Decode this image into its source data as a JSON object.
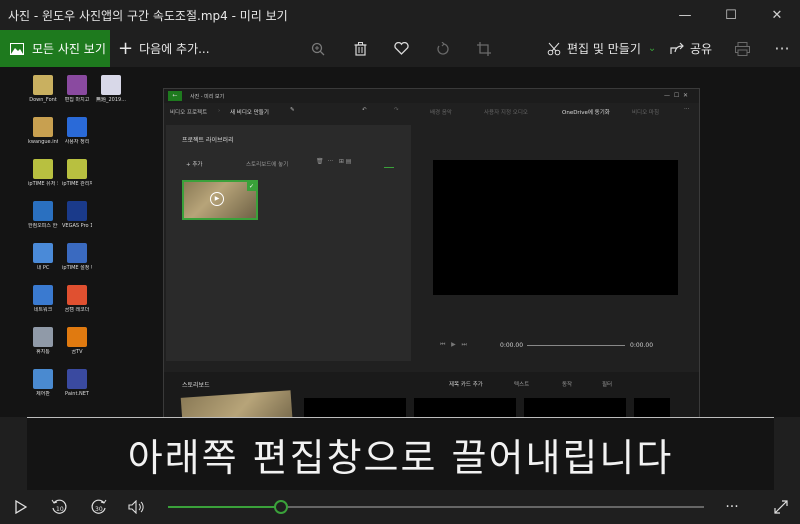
{
  "window": {
    "title": "사진 - 윈도우 사진앱의 구간 속도조절.mp4 - 미리 보기",
    "minimize": "—",
    "maximize": "☐",
    "close": "✕"
  },
  "toolbar": {
    "all_photos": "모든 사진 보기",
    "add_to": "다음에 추가...",
    "edit_create": "편집 및 만들기",
    "share": "공유",
    "more": "···"
  },
  "desktop_icons": [
    {
      "label": "Down_Font",
      "color": "#c9b060"
    },
    {
      "label": "편집 마치고",
      "color": "#8a4aa0"
    },
    {
      "label": "無題_2019...",
      "color": "#d8d8e8"
    },
    {
      "label": "kwangue.int",
      "color": "#c8a050"
    },
    {
      "label": "사용자 정리",
      "color": "#2a6ad8"
    },
    {
      "label": "ipTIME 유저 도우미",
      "color": "#b8c040"
    },
    {
      "label": "ipTIME 관리자",
      "color": "#b8c040"
    },
    {
      "label": "한컴오피스 한글 2014",
      "color": "#2a70c0"
    },
    {
      "label": "VEGAS Pro 15.0",
      "color": "#1a3a8a"
    },
    {
      "label": "내 PC",
      "color": "#4a8ad8"
    },
    {
      "label": "ipTIME 설정 마법사",
      "color": "#3a6ac0"
    },
    {
      "label": "네트워크",
      "color": "#3a7ad0"
    },
    {
      "label": "곰캠 레코더",
      "color": "#e05030"
    },
    {
      "label": "휴지통",
      "color": "#909aa8"
    },
    {
      "label": "곰TV",
      "color": "#e07a10"
    },
    {
      "label": "제어판",
      "color": "#4a8ad0"
    },
    {
      "label": "Paint.NET",
      "color": "#3a4aa0"
    }
  ],
  "editor": {
    "title": "사진 - 미리 보기",
    "nav_project": "비디오 프로젝트",
    "nav_current": "새 비디오 만들기",
    "undo_hint": "배경 음악",
    "custom_audio": "사용자 지정 오디오",
    "onedrive": "OneDrive에 동기화",
    "finish": "비디오 마침",
    "library_title": "프로젝트 라이브러리",
    "add": "추가",
    "storyboard_place": "스토리보드에 놓기",
    "time_start": "0:00.00",
    "time_end": "0:00.00",
    "storyboard_title": "스토리보드",
    "title_card": "제목 카드 추가",
    "text": "텍스트",
    "motion": "동작",
    "filter": "필터"
  },
  "caption": "아래쪽 편집창으로 끌어내립니다",
  "playback": {
    "progress": 0.21,
    "accent": "#3aa13a",
    "more": "···"
  }
}
